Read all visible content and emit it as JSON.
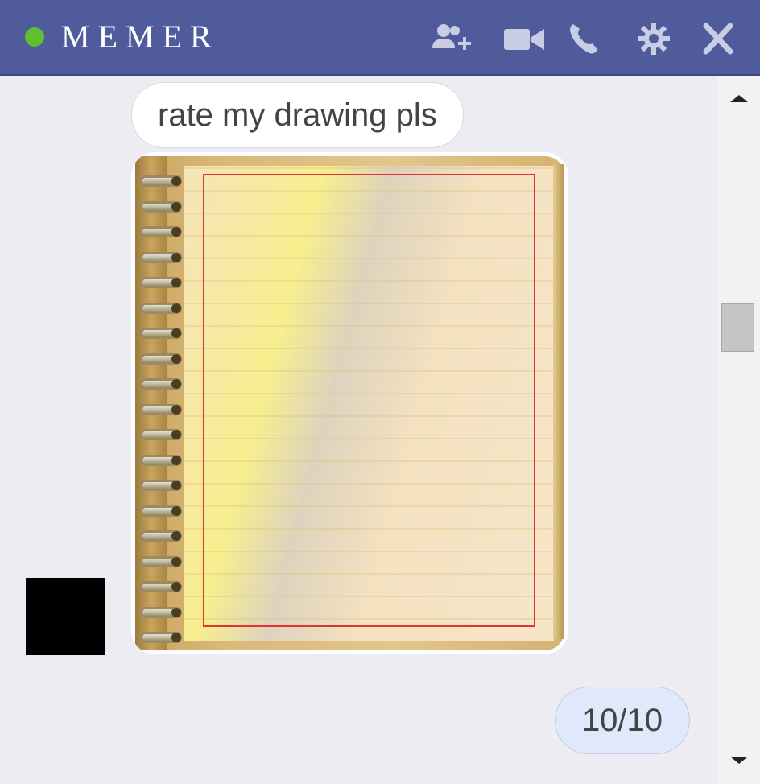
{
  "header": {
    "title": "MEMER",
    "status_color": "#5fbf2f",
    "bar_color": "#4f5b9b",
    "icons": [
      "add-user-icon",
      "video-camera-icon",
      "phone-icon",
      "gear-icon",
      "close-icon"
    ]
  },
  "messages": [
    {
      "from": "them",
      "type": "text",
      "text": "rate my drawing pls"
    },
    {
      "from": "them",
      "type": "image",
      "content": "spiral notebook drawing"
    },
    {
      "from": "me",
      "type": "text",
      "text": "10/10"
    }
  ],
  "scrollbar": {
    "up_icon": "chevron-up-icon",
    "down_icon": "chevron-down-icon"
  }
}
